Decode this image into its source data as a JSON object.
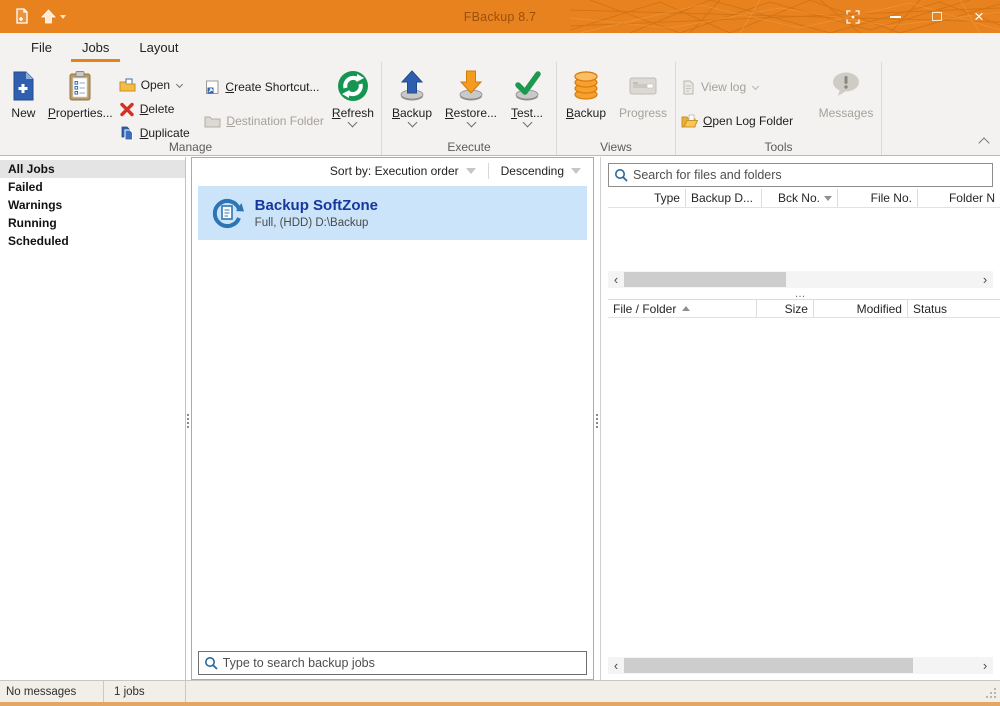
{
  "titlebar": {
    "title": "FBackup 8.7"
  },
  "tabs": {
    "file": "File",
    "jobs": "Jobs",
    "layout": "Layout"
  },
  "ribbon": {
    "groups": {
      "manage": "Manage",
      "execute": "Execute",
      "views": "Views",
      "tools": "Tools"
    },
    "buttons": {
      "new": "New",
      "properties": "Properties...",
      "open": "Open",
      "delete": "Delete",
      "duplicate": "Duplicate",
      "create_shortcut": "Create Shortcut...",
      "destination_folder": "Destination Folder",
      "refresh": "Refresh",
      "backup": "Backup",
      "restore": "Restore...",
      "test": "Test...",
      "views_backup": "Backup",
      "progress": "Progress",
      "view_log": "View log",
      "open_log_folder": "Open Log Folder",
      "messages": "Messages"
    },
    "accels": {
      "properties": 0,
      "delete": 0,
      "duplicate": 0,
      "create_shortcut": 0,
      "destination_folder": 0,
      "refresh": 0,
      "backup": 0,
      "restore": 0,
      "test": 0,
      "views_backup": 0,
      "open_log_folder": 0
    }
  },
  "sidebar": {
    "items": [
      {
        "label": "All Jobs",
        "selected": true
      },
      {
        "label": "Failed"
      },
      {
        "label": "Warnings"
      },
      {
        "label": "Running"
      },
      {
        "label": "Scheduled"
      }
    ]
  },
  "jobs_panel": {
    "sort_by": "Sort by: Execution order",
    "direction": "Descending",
    "jobs": [
      {
        "name": "Backup SoftZone",
        "details": "Full, (HDD) D:\\Backup",
        "selected": true
      }
    ],
    "search_placeholder": "Type to search backup jobs"
  },
  "files_panel": {
    "search_placeholder": "Search for files and folders",
    "versions_table": {
      "columns": [
        "Type",
        "Backup D...",
        "Bck No.",
        "File No.",
        "Folder N"
      ],
      "sorted_by": "Bck No.",
      "sort_dir": "desc"
    },
    "files_table": {
      "columns": [
        "File / Folder",
        "Size",
        "Modified",
        "Status"
      ],
      "sorted_by": "File / Folder",
      "sort_dir": "asc"
    }
  },
  "status_bar": {
    "messages": "No messages",
    "jobs": "1 jobs"
  },
  "icons": {
    "close": "×",
    "scroll_left": "‹",
    "scroll_right": "›",
    "overflow": "…"
  },
  "colors": {
    "titlebar_orange": "#E8821E",
    "accent_orange": "#E8821E",
    "selection_blue": "#CBE4F9",
    "job_title_blue": "#16379E",
    "status_bar_bg": "#F2EFE9"
  }
}
